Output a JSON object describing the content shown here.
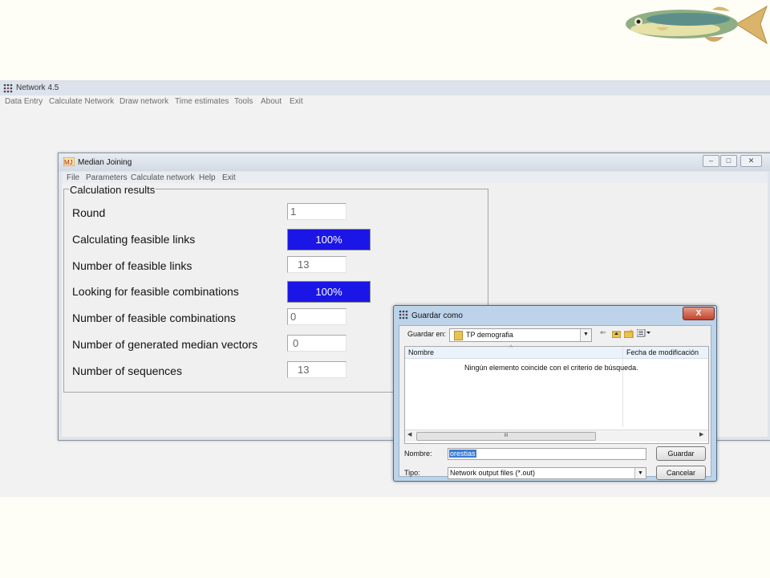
{
  "network_window": {
    "title": "Network 4.5",
    "menu": [
      "Data Entry",
      "Calculate Network",
      "Draw network",
      "Time estimates",
      "Tools",
      "About",
      "Exit"
    ]
  },
  "median_joining": {
    "title": "Median Joining",
    "menu": [
      "File",
      "Parameters",
      "Calculate network",
      "Help",
      "Exit"
    ],
    "group_title": "Calculation results",
    "rows": [
      {
        "label": "Round",
        "type": "text",
        "value": "1"
      },
      {
        "label": "Calculating feasible links",
        "type": "progress",
        "value": "100%",
        "percent": 100
      },
      {
        "label": "Number of feasible links",
        "type": "text",
        "value": "13"
      },
      {
        "label": "Looking for feasible combinations",
        "type": "progress",
        "value": "100%",
        "percent": 100
      },
      {
        "label": "Number of feasible combinations",
        "type": "text",
        "value": "0"
      },
      {
        "label": "Number of generated median vectors",
        "type": "text",
        "value": "0"
      },
      {
        "label": "Number of sequences",
        "type": "text",
        "value": "13"
      }
    ],
    "progress_color": "#1b16e6"
  },
  "save_dialog": {
    "title": "Guardar como",
    "close_label": "X",
    "save_in_label": "Guardar en:",
    "save_in_value": "TP demografia",
    "columns": [
      "Nombre",
      "Fecha de modificación"
    ],
    "empty_message": "Ningún elemento coincide con el criterio de búsqueda.",
    "name_label": "Nombre:",
    "name_value": "orestias",
    "type_label": "Tipo:",
    "type_value": "Network output files (*.out)",
    "save_button": "Guardar",
    "cancel_button": "Cancelar",
    "scroll_grip": "III"
  }
}
